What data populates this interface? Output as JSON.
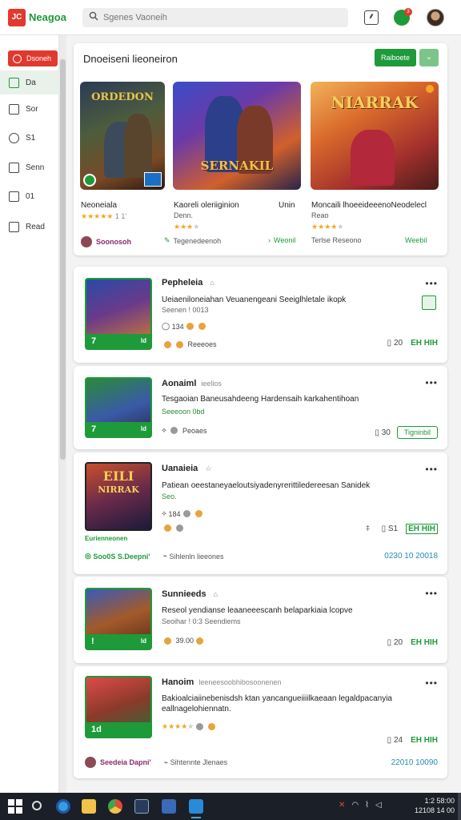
{
  "app": {
    "logo_text": "Neagoa",
    "logo_mark": "JC"
  },
  "search": {
    "placeholder": "Sgenes Vaoneih"
  },
  "header": {
    "notif_count": "3"
  },
  "sidebar": {
    "items": [
      {
        "label": "Dsoneh"
      },
      {
        "label": "Da"
      },
      {
        "label": "Sor"
      },
      {
        "label": "S1"
      },
      {
        "label": "Senn"
      },
      {
        "label": "01"
      },
      {
        "label": "Read"
      }
    ]
  },
  "featured": {
    "title": "Dnoeiseni lieoneiron",
    "primary_button": "Raiboete",
    "games": [
      {
        "cover_text": "ORDEDON",
        "title": "Neoneiala",
        "subtitle": "",
        "rating": "1 1'",
        "footer": "Soonosoh"
      },
      {
        "cover_text": "SERNAKIL",
        "title": "Kaoreli oleriiginion",
        "subtitle": "Denn.",
        "extra": "Unin",
        "footer": "Tegenedeenoh"
      },
      {
        "cover_text": "NIARRAK",
        "title": "Moncaili lhoeeideeenoNeodelecl",
        "subtitle": "Reao",
        "footer": "Terlse Reseono"
      }
    ],
    "footer_links": [
      "Tegenedeenoh",
      "Weonil",
      "Weebil"
    ]
  },
  "list": [
    {
      "title": "Pepheleia",
      "description": "Ueiaeniloneiahan Veuanengeani Seeiglhletale ikopk",
      "subtitle": "Seenen ! 0013",
      "stats": "134",
      "status": "Reeeoes",
      "right_value": "20",
      "right_label": "EH HIH",
      "thumb_num": "7",
      "thumb_side": "ld"
    },
    {
      "title": "Aonaiml",
      "tag": "ieelios",
      "description": "Tesgaoian Baneusahdeeng Hardensaih karkahentihoan",
      "subtitle": "Seeeoon 0bd",
      "status": "Peoaes",
      "right_value": "30",
      "button": "Tigninbil",
      "thumb_num": "7",
      "thumb_side": "ld"
    },
    {
      "title": "Uanaieia",
      "description": "Patiean oeestaneyaeloutsiyadenyrerittiledereesan Sanidek",
      "subtitle": "Seo.",
      "stats": "184",
      "right_value": "S1",
      "right_label": "EH HIH",
      "thumb_top": "EILI",
      "thumb_name": "NIRRAK",
      "overlay_label": "Eurienneonen",
      "footer_left": "Soo0S S.Deepni'",
      "footer_mid": "Sihlenln lieeones",
      "footer_right": "0230 10 20018"
    },
    {
      "title": "Sunnieeds",
      "description": "Reseol yendianse leaaneeescanh belaparkiaia lcopve",
      "subtitle": "Seoihar ! 0:3 Seendiems",
      "stats": "39.00",
      "right_value": "20",
      "right_label": "EH HIH",
      "thumb_num": "!",
      "thumb_side": "ld"
    },
    {
      "title": "Hanoim",
      "tag": "leeneesoobhibosoonenen",
      "description": "Bakioalciaiinebenisdsh ktan yancangueiiiilkaeaan legaldpacanyia",
      "description2": "eallnagelohiennatn.",
      "right_value": "24",
      "right_label": "EH HIH",
      "thumb_num": "1d",
      "footer_left": "Seedeia Dapni'",
      "footer_mid": "Sihtennte Jlenaes",
      "footer_right": "22010 10090"
    }
  ],
  "taskbar": {
    "time": "1:2 58:00",
    "date": "12108 14 00"
  }
}
